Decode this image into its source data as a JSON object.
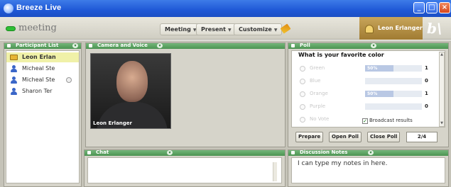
{
  "window": {
    "title": "Breeze Live"
  },
  "menubar": {
    "meeting_name": "meeting",
    "menus": [
      {
        "label": "Meeting"
      },
      {
        "label": "Present"
      },
      {
        "label": "Customize"
      }
    ],
    "user_name": "Leon Erlanger",
    "logo_text": "b\\"
  },
  "pods": {
    "attendees": {
      "title": "Participant List",
      "items": [
        {
          "name": "Leon Erlan",
          "role": "host"
        },
        {
          "name": "Micheal Ste",
          "role": "participant"
        },
        {
          "name": "Micheal Ste",
          "role": "participant"
        },
        {
          "name": "Sharon Ter",
          "role": "participant"
        }
      ]
    },
    "camera": {
      "title": "Camera and Voice",
      "video_label": "Leon Erlanger"
    },
    "poll": {
      "title": "Poll",
      "question": "What is your favorite color",
      "options": [
        {
          "label": "Green",
          "percent": "50%",
          "fraction": 0.5,
          "count": "1"
        },
        {
          "label": "Blue",
          "percent": "",
          "fraction": 0,
          "count": "0"
        },
        {
          "label": "Orange",
          "percent": "50%",
          "fraction": 0.5,
          "count": "1"
        },
        {
          "label": "Purple",
          "percent": "",
          "fraction": 0,
          "count": "0"
        },
        {
          "label": "No Vote",
          "percent": "",
          "fraction": 0,
          "count": ""
        }
      ],
      "broadcast_label": "Broadcast results",
      "broadcast_checked": true,
      "buttons": {
        "prepare": "Prepare",
        "open": "Open Poll",
        "close": "Close Poll"
      },
      "page": "2/4"
    },
    "chat": {
      "title": "Chat"
    },
    "notes": {
      "title": "Discussion Notes",
      "text": "I can type my notes in here."
    }
  },
  "colors": {
    "title_bar": "#1f58d6",
    "pod_header": "#4b9452",
    "host_highlight": "#f0f1a8"
  },
  "icons": [
    "app-icon",
    "minimize-icon",
    "maximize-icon",
    "close-icon",
    "pencil-icon",
    "user-icon",
    "person-icon",
    "mic-icon",
    "pod-menu-icon",
    "pod-options-icon"
  ]
}
